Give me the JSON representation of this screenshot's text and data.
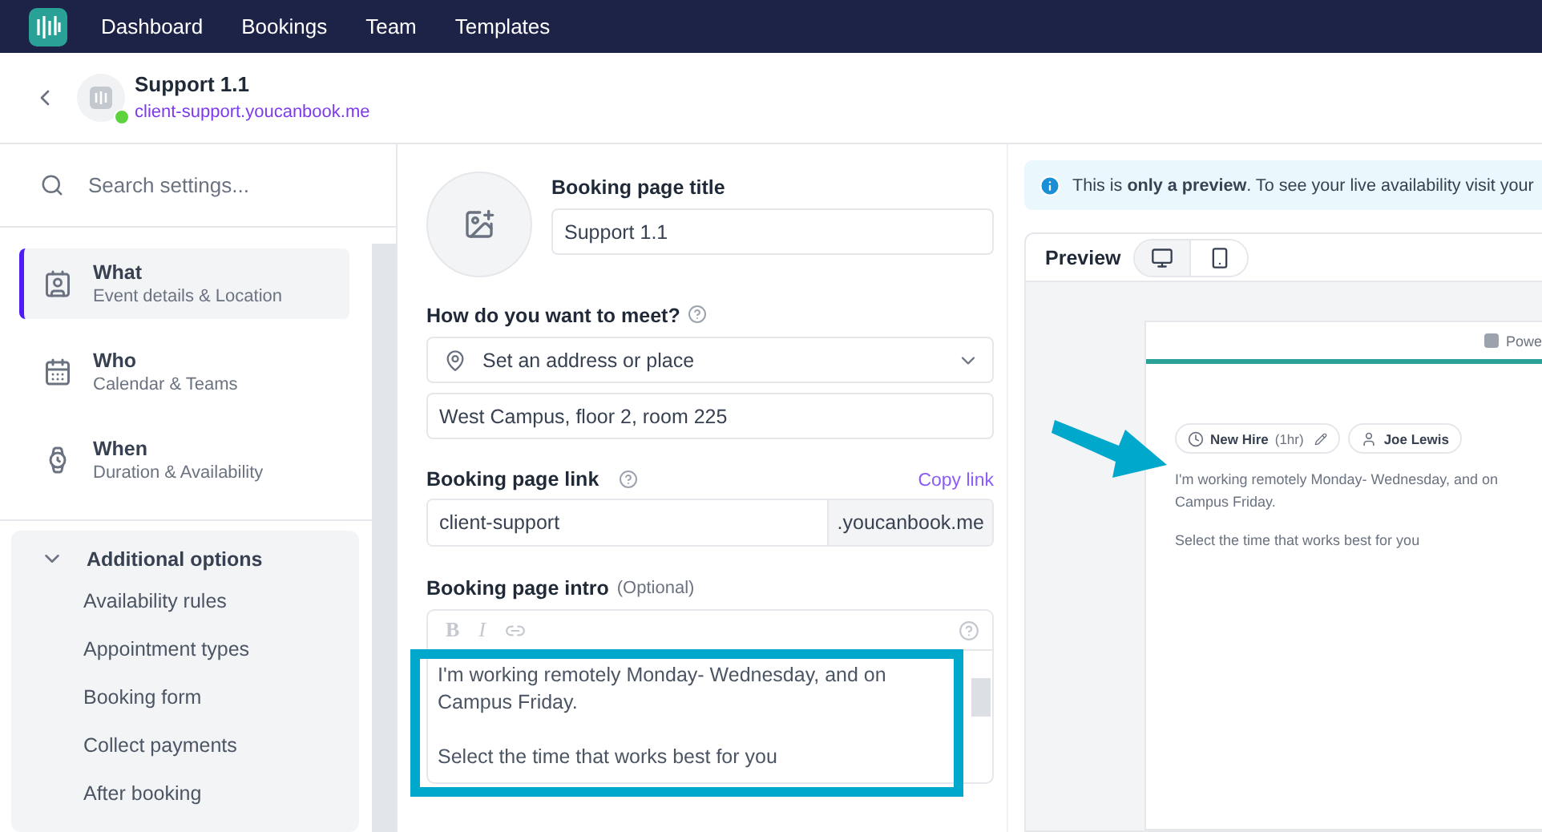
{
  "nav": {
    "items": [
      {
        "label": "Dashboard",
        "selected": false
      },
      {
        "label": "Bookings",
        "selected": false
      },
      {
        "label": "Team",
        "selected": false
      },
      {
        "label": "Templates",
        "selected": false
      }
    ]
  },
  "header": {
    "title": "Support 1.1",
    "link": "client-support.youcanbook.me",
    "online": true
  },
  "sidebar": {
    "search": {
      "placeholder": "Search settings..."
    },
    "items": [
      {
        "title": "What",
        "subtitle": "Event details & Location",
        "kind": "card",
        "selected": true
      },
      {
        "title": "Who",
        "subtitle": "Calendar & Teams",
        "kind": "calendar",
        "selected": false
      },
      {
        "title": "When",
        "subtitle": "Duration & Availability",
        "kind": "watch",
        "selected": false
      }
    ],
    "additional": {
      "title": "Additional options",
      "expanded": true,
      "items": [
        "Availability rules",
        "Appointment types",
        "Booking form",
        "Collect payments",
        "After booking"
      ]
    }
  },
  "form": {
    "title_label": "Booking page title",
    "title_value": "Support 1.1",
    "meet_label": "How do you want to meet?",
    "meet_select": "Set an address or place",
    "address_value": "West Campus, floor 2, room 225",
    "link_label": "Booking page link",
    "copy_link": "Copy link",
    "link_value": "client-support",
    "link_suffix": ".youcanbook.me",
    "intro_label": "Booking page intro",
    "intro_optional": "(Optional)",
    "toolbar": [
      "B",
      "I"
    ],
    "intro_lines": [
      "I'm working remotely Monday- Wednesday, and on Campus Friday.",
      "Select the time that works best for you"
    ]
  },
  "preview": {
    "banner": "This is **only a preview**. To see your live availability visit your",
    "title": "Preview",
    "devices": [
      {
        "kind": "desktop",
        "selected": true
      },
      {
        "kind": "mobile",
        "selected": false
      }
    ],
    "powered": "Powe",
    "chips": [
      {
        "kind": "event",
        "label": "New Hire",
        "extra": "(1hr)"
      },
      {
        "kind": "person",
        "label": "Joe Lewis"
      }
    ],
    "paragraphs": [
      "I'm working remotely Monday- Wednesday, and on Campus Friday.",
      "Select the time that works best for you"
    ]
  }
}
